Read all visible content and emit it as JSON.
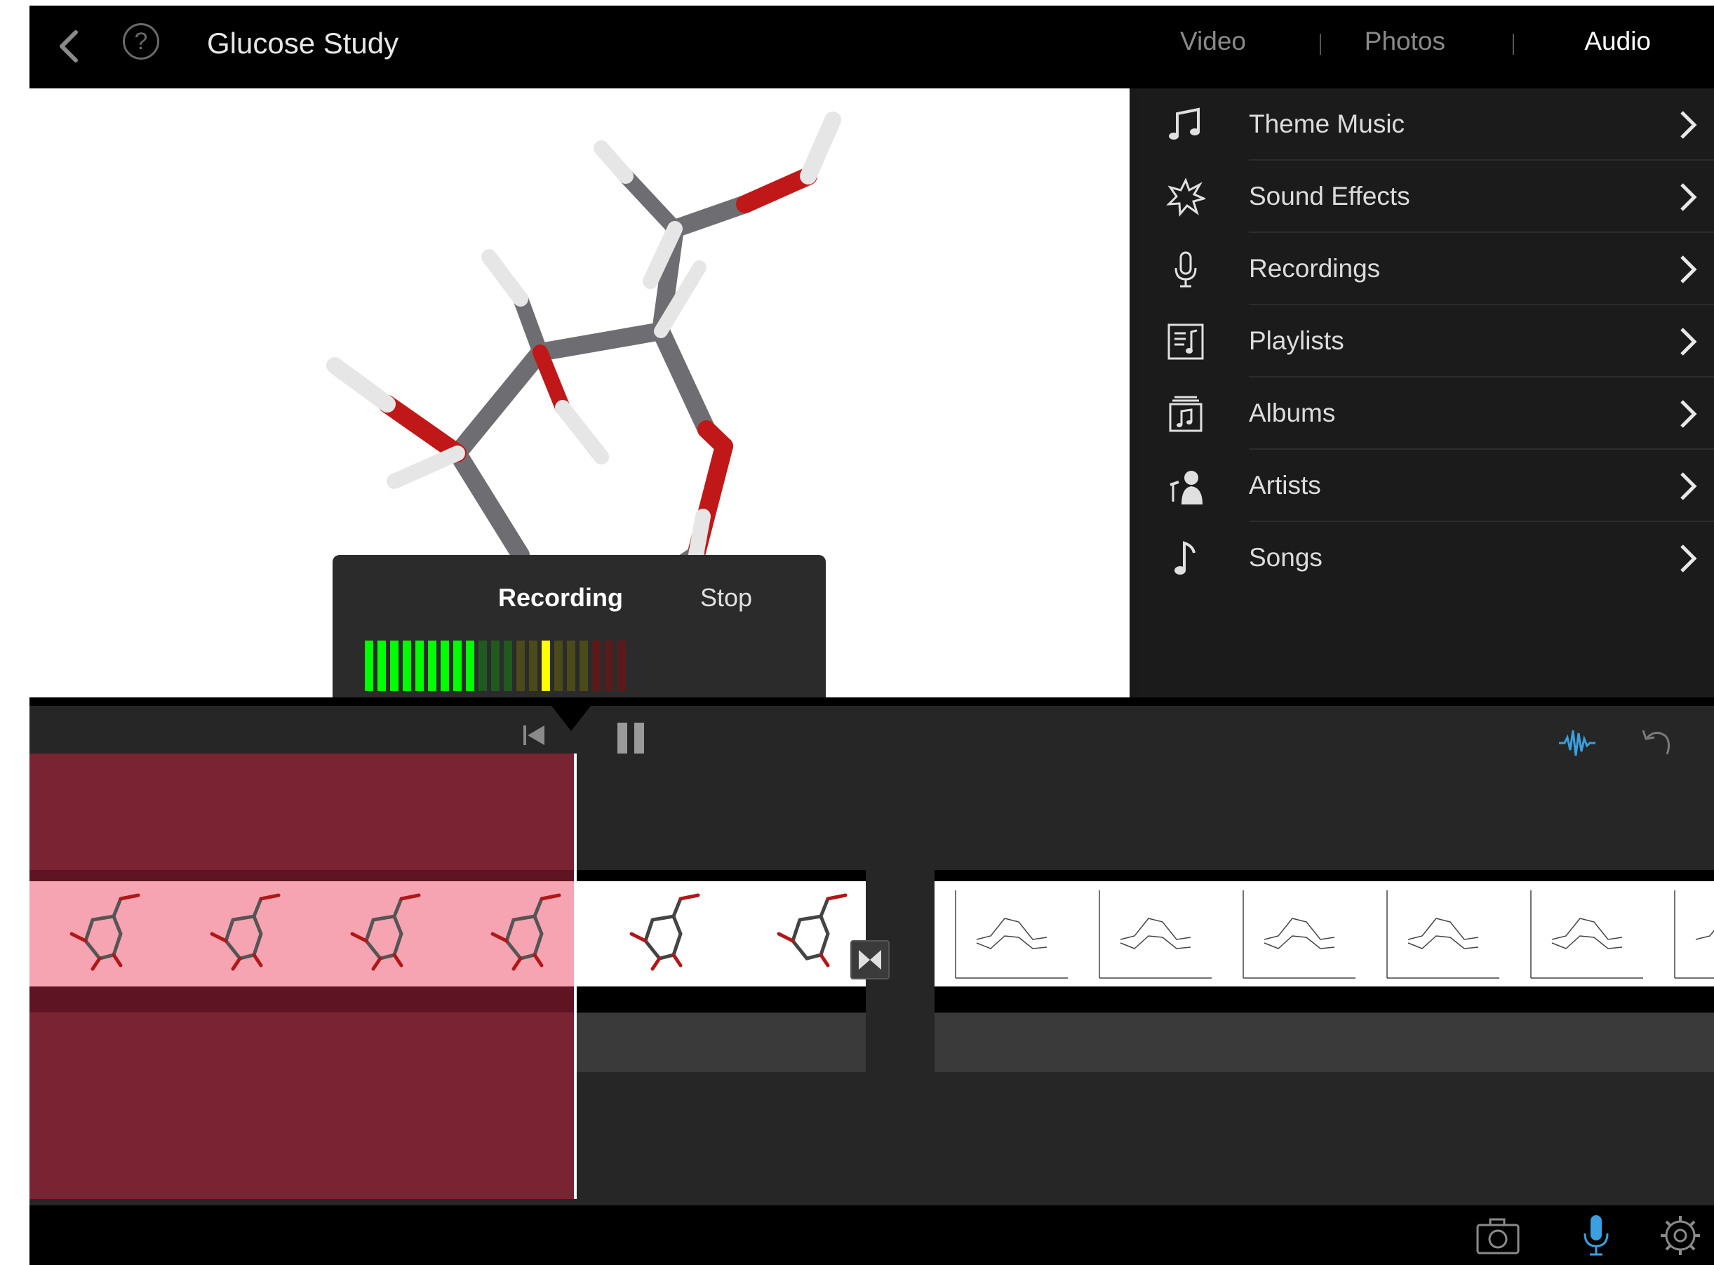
{
  "app": {
    "title": "Glucose Study"
  },
  "tabs": [
    {
      "label": "Video",
      "active": false
    },
    {
      "label": "Photos",
      "active": false
    },
    {
      "label": "Audio",
      "active": true
    }
  ],
  "audio_menu": {
    "items": [
      {
        "label": "Theme Music",
        "icon": "music-note-icon"
      },
      {
        "label": "Sound Effects",
        "icon": "starburst-icon"
      },
      {
        "label": "Recordings",
        "icon": "microphone-icon"
      },
      {
        "label": "Playlists",
        "icon": "playlist-icon"
      },
      {
        "label": "Albums",
        "icon": "album-icon"
      },
      {
        "label": "Artists",
        "icon": "artist-icon"
      },
      {
        "label": "Songs",
        "icon": "song-note-icon"
      }
    ]
  },
  "recording": {
    "label": "Recording",
    "stop_label": "Stop",
    "level": 0.42
  },
  "colors": {
    "accent_blue": "#3aa0e0",
    "record_region": "#7a2433",
    "meter_green": "#00ff00",
    "meter_yellow": "#ffff00"
  }
}
